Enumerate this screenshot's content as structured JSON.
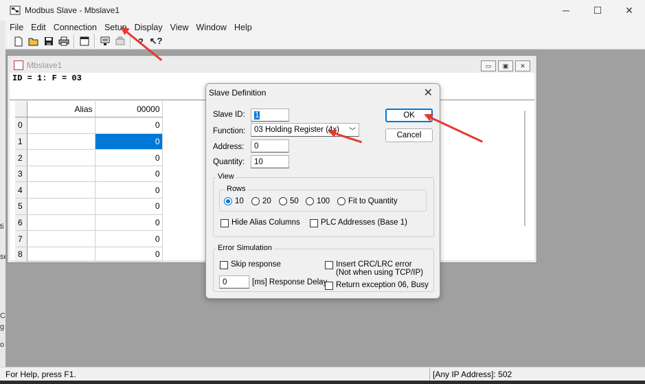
{
  "window": {
    "title": "Modbus Slave - Mbslave1",
    "minimize": "─",
    "maximize": "☐",
    "close": "✕"
  },
  "menu": {
    "items": [
      "File",
      "Edit",
      "Connection",
      "Setup",
      "Display",
      "View",
      "Window",
      "Help"
    ]
  },
  "toolbar": {
    "icons": [
      "new-icon",
      "open-icon",
      "save-icon",
      "print-icon",
      "window-icon",
      "connect-icon",
      "disconnect-icon",
      "help-icon",
      "context-help-icon"
    ]
  },
  "child": {
    "title": "Mbslave1",
    "header": "ID = 1: F = 03",
    "columns": {
      "alias": "Alias",
      "value": "00000"
    },
    "rows": [
      {
        "index": "0",
        "value": "0"
      },
      {
        "index": "1",
        "value": "0"
      },
      {
        "index": "2",
        "value": "0"
      },
      {
        "index": "3",
        "value": "0"
      },
      {
        "index": "4",
        "value": "0"
      },
      {
        "index": "5",
        "value": "0"
      },
      {
        "index": "6",
        "value": "0"
      },
      {
        "index": "7",
        "value": "0"
      },
      {
        "index": "8",
        "value": "0"
      }
    ],
    "selected_row": 1
  },
  "dialog": {
    "title": "Slave Definition",
    "slave_id_label": "Slave ID:",
    "slave_id": "1",
    "function_label": "Function:",
    "function_value": "03 Holding Register (4x)",
    "address_label": "Address:",
    "address": "0",
    "quantity_label": "Quantity:",
    "quantity": "10",
    "ok": "OK",
    "cancel": "Cancel",
    "view_group": "View",
    "rows_group": "Rows",
    "row_options": [
      "10",
      "20",
      "50",
      "100",
      "Fit to Quantity"
    ],
    "row_selected": "10",
    "hide_alias": "Hide Alias Columns",
    "plc_addresses": "PLC Addresses (Base 1)",
    "error_group": "Error Simulation",
    "skip_response": "Skip response",
    "insert_crc": "Insert CRC/LRC error",
    "insert_crc_note": "(Not when using TCP/IP)",
    "response_delay_value": "0",
    "response_delay_label": "[ms] Response Delay",
    "return_exception": "Return exception 06, Busy"
  },
  "status": {
    "left": "For Help, press F1.",
    "right": "[Any IP Address]: 502"
  },
  "colors": {
    "accent": "#0078d7",
    "annotation": "#e53935"
  }
}
